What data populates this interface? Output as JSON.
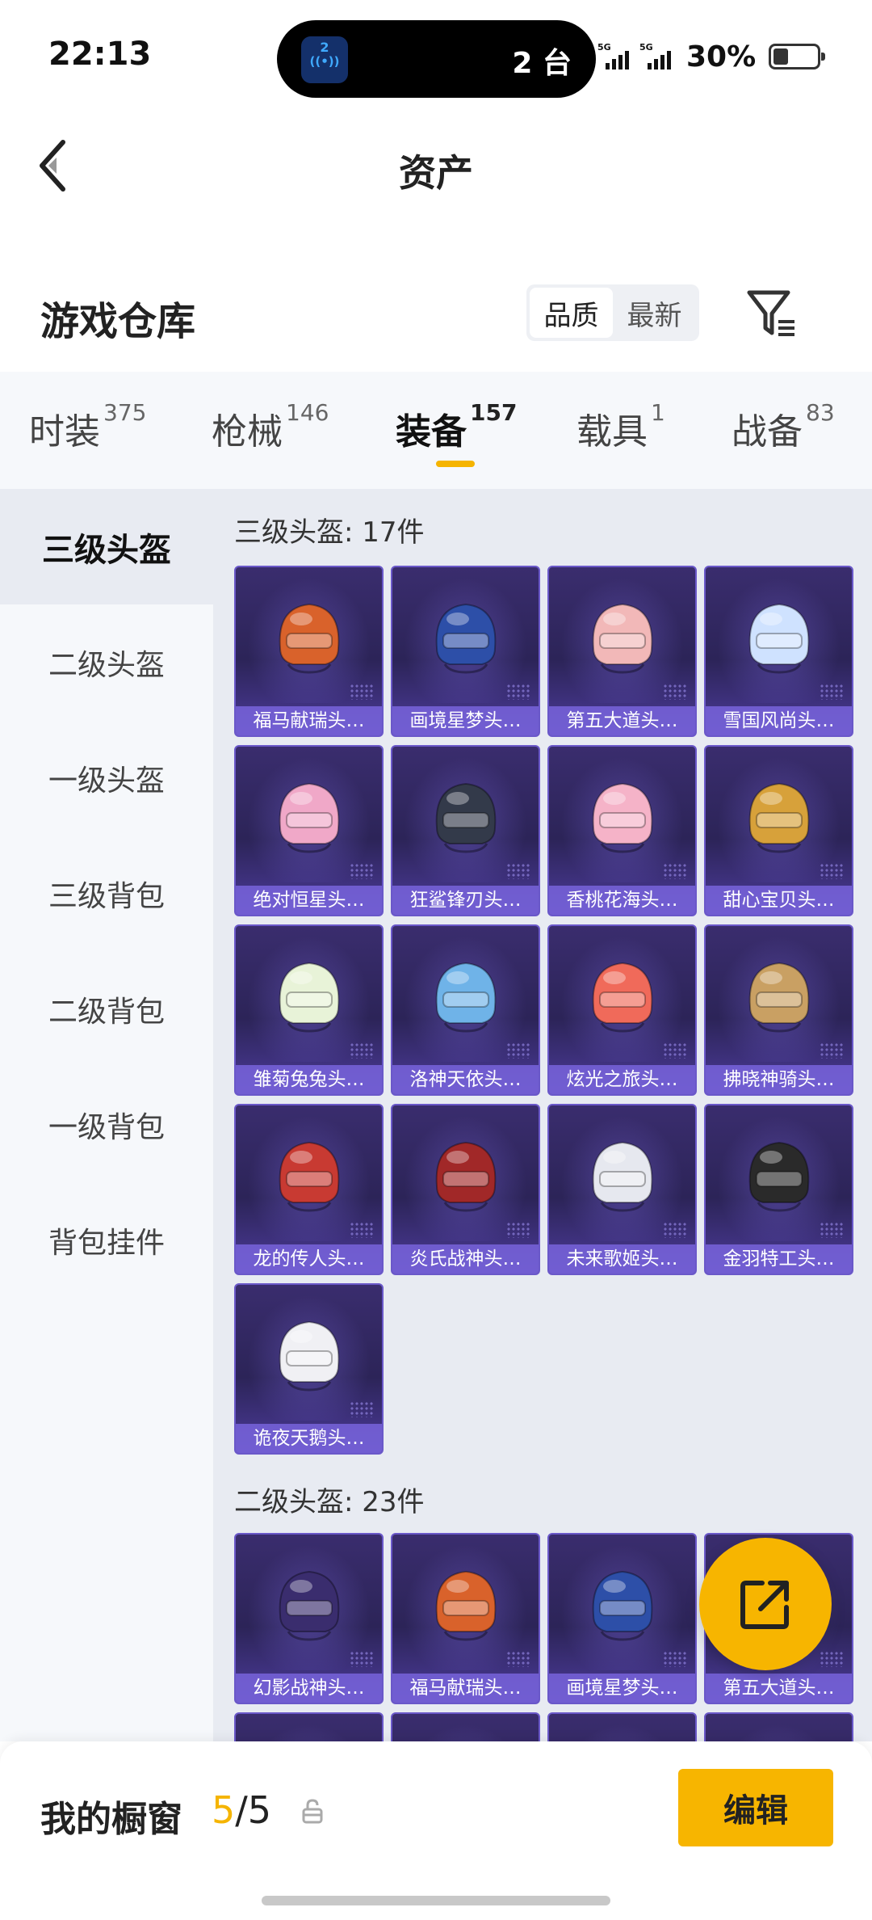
{
  "status_bar": {
    "time": "22:13",
    "island_text": "2 台",
    "network1": "5G",
    "network2": "5G",
    "battery_text": "30%",
    "battery_level": 0.3
  },
  "header": {
    "title": "资产"
  },
  "warehouse": {
    "title": "游戏仓库",
    "sort_options": [
      "品质",
      "最新"
    ],
    "sort_selected": "品质"
  },
  "tabs": [
    {
      "label": "时装",
      "count": "375"
    },
    {
      "label": "枪械",
      "count": "146"
    },
    {
      "label": "装备",
      "count": "157",
      "active": true
    },
    {
      "label": "载具",
      "count": "1"
    },
    {
      "label": "战备",
      "count": "83"
    }
  ],
  "sidebar": [
    {
      "label": "三级头盔",
      "active": true
    },
    {
      "label": "二级头盔"
    },
    {
      "label": "一级头盔"
    },
    {
      "label": "三级背包"
    },
    {
      "label": "二级背包"
    },
    {
      "label": "一级背包"
    },
    {
      "label": "背包挂件"
    }
  ],
  "sections": [
    {
      "title": "三级头盔: 17件",
      "items": [
        {
          "name": "福马献瑞头…",
          "color": "#d9622b"
        },
        {
          "name": "画境星梦头…",
          "color": "#2d4fa8"
        },
        {
          "name": "第五大道头…",
          "color": "#f2b8b8"
        },
        {
          "name": "雪国风尚头…",
          "color": "#cfe2ff"
        },
        {
          "name": "绝对恒星头…",
          "color": "#f0a8c8"
        },
        {
          "name": "狂鲨锋刃头…",
          "color": "#333a4a"
        },
        {
          "name": "香桃花海头…",
          "color": "#f5b3c8"
        },
        {
          "name": "甜心宝贝头…",
          "color": "#d7a13a"
        },
        {
          "name": "雏菊兔兔头…",
          "color": "#e8f3d8"
        },
        {
          "name": "洛神天依头…",
          "color": "#6fb3e8"
        },
        {
          "name": "炫光之旅头…",
          "color": "#f06a5a"
        },
        {
          "name": "拂晓神骑头…",
          "color": "#c9a063"
        },
        {
          "name": "龙的传人头…",
          "color": "#c83a32"
        },
        {
          "name": "炎氏战神头…",
          "color": "#a12828"
        },
        {
          "name": "未来歌姬头…",
          "color": "#e6e8ef"
        },
        {
          "name": "金羽特工头…",
          "color": "#2a2a2a"
        },
        {
          "name": "诡夜天鹅头…",
          "color": "#f0f0f4"
        }
      ]
    },
    {
      "title": "二级头盔: 23件",
      "items": [
        {
          "name": "幻影战神头…",
          "color": "#3a2d6e"
        },
        {
          "name": "福马献瑞头…",
          "color": "#d9622b"
        },
        {
          "name": "画境星梦头…",
          "color": "#2d4fa8"
        },
        {
          "name": "第五大道头…",
          "color": "#f2b8b8"
        },
        {
          "name": "",
          "color": "#3a2d6e"
        },
        {
          "name": "",
          "color": "#3a2d6e"
        },
        {
          "name": "",
          "color": "#3a2d6e"
        },
        {
          "name": "",
          "color": "#3a2d6e"
        }
      ]
    }
  ],
  "bottom": {
    "label": "我的橱窗",
    "current": "5",
    "separator": "/",
    "total": "5",
    "edit_label": "编辑"
  },
  "colors": {
    "accent": "#f7b500",
    "card_bg": "#3a2d6e",
    "card_label": "#7864dc"
  }
}
